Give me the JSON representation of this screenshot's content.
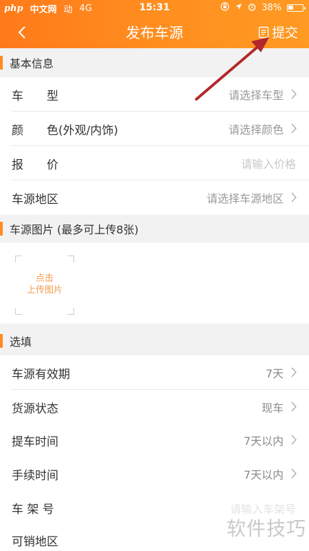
{
  "status_bar": {
    "site_logo": "php",
    "site_name": "中文网",
    "carrier": "动",
    "network": "4G",
    "time": "15:31",
    "battery": "38%",
    "battery_level": 0.38
  },
  "nav": {
    "title": "发布车源",
    "submit_label": "提交"
  },
  "sections": {
    "basic": "基本信息",
    "photos": "车源图片 (最多可上传8张)",
    "optional": "选填"
  },
  "basic_rows": [
    {
      "label": "车　　型",
      "value": "请选择车型"
    },
    {
      "label": "颜　　色(外观/内饰)",
      "value": "请选择颜色"
    },
    {
      "label": "报　　价",
      "value": "请输入价格"
    },
    {
      "label": "车源地区",
      "value": "请选择车源地区"
    }
  ],
  "upload": {
    "line1": "点击",
    "line2": "上传图片"
  },
  "optional_rows": [
    {
      "label": "车源有效期",
      "value": "7天"
    },
    {
      "label": "货源状态",
      "value": "现车"
    },
    {
      "label": "提车时间",
      "value": "7天以内"
    },
    {
      "label": "手续时间",
      "value": "7天以内"
    },
    {
      "label": "车 架 号",
      "value": "请输入车架号"
    },
    {
      "label": "可销地区",
      "value": ""
    }
  ],
  "watermark": "软件技巧",
  "colors": {
    "accent": "#ff8a1f",
    "annotation_arrow": "#b3282c"
  }
}
